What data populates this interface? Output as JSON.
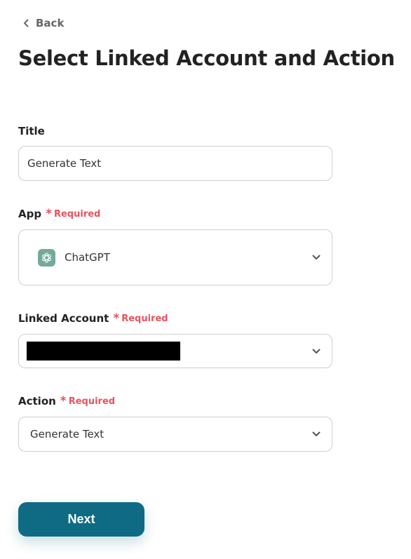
{
  "back_label": "Back",
  "page_title": "Select Linked Account and Action",
  "required_label": "Required",
  "required_mark": "*",
  "title_field": {
    "label": "Title",
    "value": "Generate Text"
  },
  "app_field": {
    "label": "App",
    "value": "ChatGPT",
    "icon": "chatgpt-logo-icon"
  },
  "linked_account_field": {
    "label": "Linked Account",
    "value": ""
  },
  "action_field": {
    "label": "Action",
    "value": "Generate Text"
  },
  "next_label": "Next",
  "colors": {
    "primary": "#0f6b84",
    "required": "#e8525d",
    "border": "#cfcfcf",
    "app_icon_bg": "#74aa9c"
  }
}
